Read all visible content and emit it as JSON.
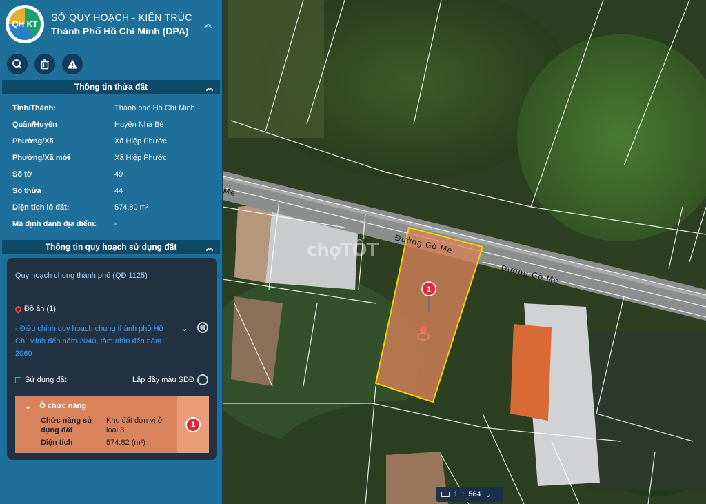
{
  "header": {
    "title_line1": "SỞ QUY HOẠCH - KIẾN TRÚC",
    "title_line2": "Thành Phố Hồ Chí Minh (DPA)",
    "logo_text": "QH KT"
  },
  "parcel": {
    "section_title": "Thông tin thửa đất",
    "rows": [
      {
        "label": "Tỉnh/Thành:",
        "value": "Thành phố Hồ Chí Minh"
      },
      {
        "label": "Quận/Huyện",
        "value": "Huyện Nhà Bè"
      },
      {
        "label": "Phường/Xã",
        "value": "Xã Hiệp Phước"
      },
      {
        "label": "Phường/Xã mới",
        "value": "Xã Hiệp Phước"
      },
      {
        "label": "Số tờ",
        "value": "49"
      },
      {
        "label": "Số thửa",
        "value": "44"
      },
      {
        "label": "Diện tích lô đất:",
        "value": "574.80 m²"
      },
      {
        "label": "Mã định danh địa điểm:",
        "value": "-"
      }
    ]
  },
  "planning": {
    "section_title": "Thông tin quy hoạch sử dụng đất",
    "general_plan": "Quy hoạch chung thành phố (QĐ 1125)",
    "doan_label": "Đồ án (1)",
    "doan_item": "- Điều chỉnh quy hoạch chung thành phố Hồ Chí Minh đến năm 2040, tầm nhìn đến năm 2060",
    "land_use_label": "Sử dụng đất",
    "fill_label": "Lấp đầy màu SDĐ",
    "function_cell": {
      "title": "Ô chức năng",
      "rows": [
        {
          "key": "Chức năng sử dụng đất",
          "value": "Khu đất đơn vị ở loại 3"
        },
        {
          "key": "Diện tích",
          "value": "574.82 (m²)"
        }
      ],
      "badge": "1"
    }
  },
  "map": {
    "road_labels": [
      "Đường Gò Me",
      "Đường Gò Me",
      "Me"
    ],
    "marker_number": "1",
    "watermark": "chợTỐT",
    "scale_prefix": "1",
    "scale_value": "564"
  },
  "colors": {
    "panel": "#1f6f9b",
    "section_bar": "#0f4969",
    "card": "#233243",
    "function_box": "#d9835d",
    "parcel_border": "#f2d200",
    "marker": "#e0283a"
  }
}
